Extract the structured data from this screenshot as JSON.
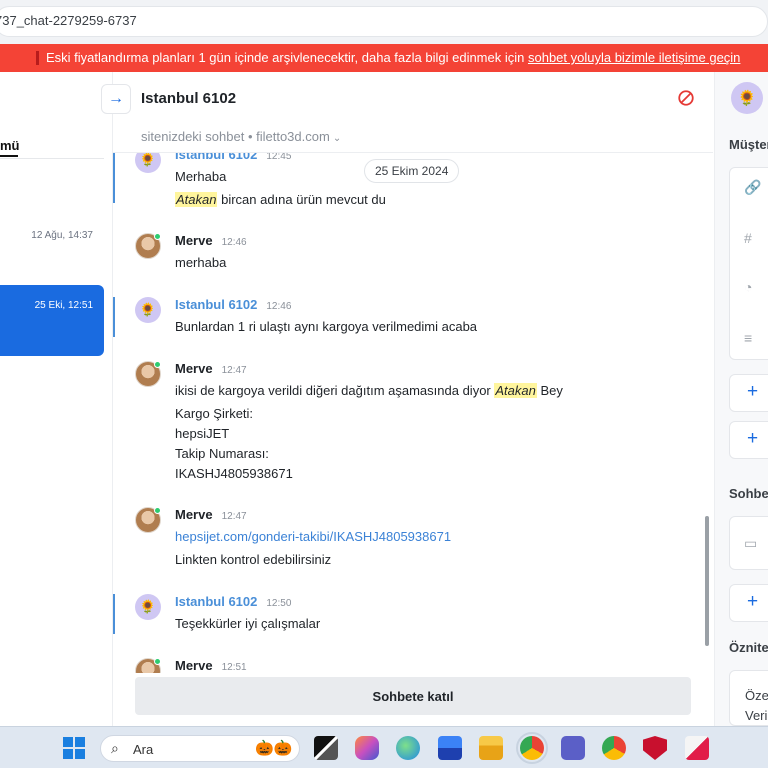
{
  "browser": {
    "url": "737_chat-2279259-6737"
  },
  "banner": {
    "text": "Eski fiyatlandırma planları 1 gün içinde arşivlenecektir, daha fazla bilgi edinmek için",
    "link": "sohbet yoluyla bizimle iletişime geçin"
  },
  "left_panel": {
    "tab_label": "mü",
    "items": [
      {
        "time": "12 Ağu, 14:37"
      },
      {
        "time": "25 Eki, 12:51",
        "selected": true
      }
    ]
  },
  "chat": {
    "title": "Istanbul 6102",
    "subtitle": "sitenizdeki sohbet • filetto3d.com",
    "date_pill": "25 Ekim 2024",
    "messages": [
      {
        "sender": "Istanbul 6102",
        "time": "12:45",
        "lines": [
          "Merhaba"
        ],
        "mention_line": {
          "mention": "Atakan",
          "rest": " bircan adına ürün mevcut du"
        }
      },
      {
        "sender": "Merve",
        "time": "12:46",
        "lines": [
          "merhaba"
        ]
      },
      {
        "sender": "Istanbul 6102",
        "time": "12:46",
        "lines": [
          "Bunlardan 1 ri ulaştı aynı kargoya verilmedimi acaba"
        ]
      },
      {
        "sender": "Merve",
        "time": "12:47",
        "line_pre": "ikisi de kargoya verildi diğeri dağıtım aşamasında diyor ",
        "mention": "Atakan",
        "line_post": " Bey",
        "lines": [
          "Kargo Şirketi:",
          "hepsiJET",
          "Takip Numarası:",
          "IKASHJ4805938671"
        ]
      },
      {
        "sender": "Merve",
        "time": "12:47",
        "link": "hepsijet.com/gonderi-takibi/IKASHJ4805938671",
        "lines": [
          "Linkten kontrol edebilirsiniz"
        ]
      },
      {
        "sender": "Istanbul 6102",
        "time": "12:50",
        "lines": [
          "Teşekkürler iyi çalışmalar"
        ]
      },
      {
        "sender": "Merve",
        "time": "12:51",
        "lines": []
      }
    ],
    "join_button": "Sohbete katıl"
  },
  "right_panel": {
    "section1": "Müşter",
    "section2": "Sohbet",
    "section3": "Öznite",
    "text1": "Öze",
    "text2": "Veri"
  },
  "taskbar": {
    "search_label": "Ara"
  },
  "colors": {
    "banner": "#f44336",
    "accent": "#1a6be0",
    "customer_name": "#4a8fd8",
    "mention_highlight": "#fff59d"
  }
}
